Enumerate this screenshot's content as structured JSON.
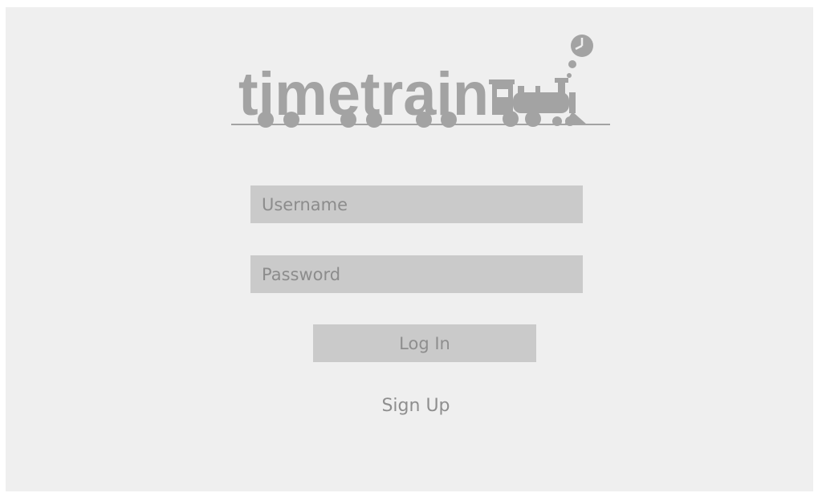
{
  "app": {
    "logo_text": "timetrain",
    "logo_icon": "steam-train-clock-icon"
  },
  "form": {
    "username_placeholder": "Username",
    "password_placeholder": "Password",
    "login_label": "Log In",
    "signup_label": "Sign Up"
  },
  "colors": {
    "background": "#efefef",
    "field_background": "#cacaca",
    "text": "#8e8e8e",
    "logo": "#a3a3a3"
  }
}
